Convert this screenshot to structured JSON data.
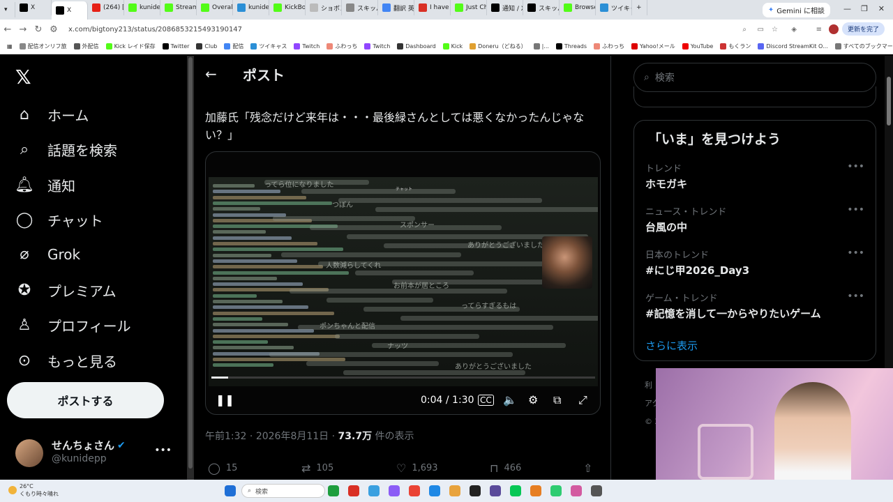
{
  "browser": {
    "tabs": [
      {
        "label": "X",
        "color": "#000000"
      },
      {
        "label": "X",
        "color": "#000000",
        "active": true
      },
      {
        "label": "(264) [",
        "color": "#e62117"
      },
      {
        "label": "kunide",
        "color": "#53fc18"
      },
      {
        "label": "Stream",
        "color": "#53fc18"
      },
      {
        "label": "Overall",
        "color": "#53fc18"
      },
      {
        "label": "kunide",
        "color": "#2b8fd6"
      },
      {
        "label": "KickBo",
        "color": "#53fc18"
      },
      {
        "label": "ショボン",
        "color": "#bbbbbb"
      },
      {
        "label": "スキッパ",
        "color": "#888888"
      },
      {
        "label": "翻訳 英",
        "color": "#4285f4"
      },
      {
        "label": "I have c",
        "color": "#d93025"
      },
      {
        "label": "Just Ch",
        "color": "#53fc18"
      },
      {
        "label": "通知 / X",
        "color": "#000000"
      },
      {
        "label": "スキッパ",
        "color": "#000000"
      },
      {
        "label": "Browse",
        "color": "#53fc18"
      },
      {
        "label": "ツイキャ",
        "color": "#2b8fd6"
      }
    ],
    "gemini_tab": "Gemini に相談",
    "url": "x.com/bigtony213/status/2086853215493190147",
    "update_button": "更新を完了",
    "bookmarks": [
      "配信オンリフ旅",
      "外配信",
      "Kick レイド保存",
      "Twitter",
      "Club",
      "配信",
      "ツイキャス",
      "Twitch",
      "ふわっち",
      "Twitch",
      "Dashboard",
      "Kick",
      "Doneru（どねる）",
      "|...",
      "Threads",
      "ふわっち",
      "Yahoo!メール",
      "YouTube",
      "もくラン",
      "Discord StreamKit O...",
      "すべてのブックマーク"
    ]
  },
  "sidebar": {
    "items": [
      {
        "label": "ホーム",
        "icon": "home-icon"
      },
      {
        "label": "話題を検索",
        "icon": "search-icon"
      },
      {
        "label": "通知",
        "icon": "bell-icon"
      },
      {
        "label": "チャット",
        "icon": "chat-icon"
      },
      {
        "label": "Grok",
        "icon": "grok-icon"
      },
      {
        "label": "プレミアム",
        "icon": "premium-icon"
      },
      {
        "label": "プロフィール",
        "icon": "profile-icon"
      },
      {
        "label": "もっと見る",
        "icon": "more-icon"
      }
    ],
    "post_button": "ポストする",
    "profile": {
      "name": "せんちょさん",
      "handle": "@kunidepp"
    }
  },
  "main": {
    "title": "ポスト",
    "post_text": "加藤氏「残念だけど来年は・・・最後緑さんとしては悪くなかったんじゃない？」",
    "video": {
      "time": "0:04 / 1:30",
      "progress_fraction": 0.044,
      "overlay_text": [
        "ってら位になりました",
        "つぼん",
        "スポンサー",
        "ありがとうございました",
        "人数減らしてくれ",
        "お前本が居ところ",
        "ってらすぎるもは",
        "ポンちゃんと配信",
        "ナッツ",
        "ありがとうございました"
      ],
      "chat_title": "チャット"
    },
    "meta": {
      "time": "午前1:32",
      "date": "2026年8月11日",
      "views": "73.7万",
      "views_suffix": "件の表示"
    },
    "actions": {
      "replies": "15",
      "reposts": "105",
      "likes": "1,693",
      "bookmarks": "466"
    }
  },
  "right": {
    "search_placeholder": "検索",
    "trends_title": "「いま」を見つけよう",
    "trends": [
      {
        "context": "トレンド",
        "name": "ホモガキ"
      },
      {
        "context": "ニュース・トレンド",
        "name": "台風の中"
      },
      {
        "context": "日本のトレンド",
        "name": "#にじ甲2026_Day3"
      },
      {
        "context": "ゲーム・トレンド",
        "name": "#記憶を消して一からやりたいゲーム"
      }
    ],
    "show_more": "さらに表示",
    "footer": [
      "利",
      "アク",
      "© 2"
    ]
  },
  "taskbar": {
    "weather_temp": "26°C",
    "weather_desc": "くもり時々晴れ",
    "search": "検索"
  }
}
